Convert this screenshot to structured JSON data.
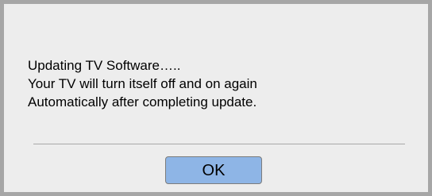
{
  "dialog": {
    "message_lines": [
      "Updating TV Software…..",
      "Your TV will turn itself off and on again",
      "Automatically after completing update."
    ],
    "ok_label": "OK"
  },
  "colors": {
    "background": "#ededed",
    "border": "#a6a6a6",
    "button": "#8eb5e6"
  }
}
